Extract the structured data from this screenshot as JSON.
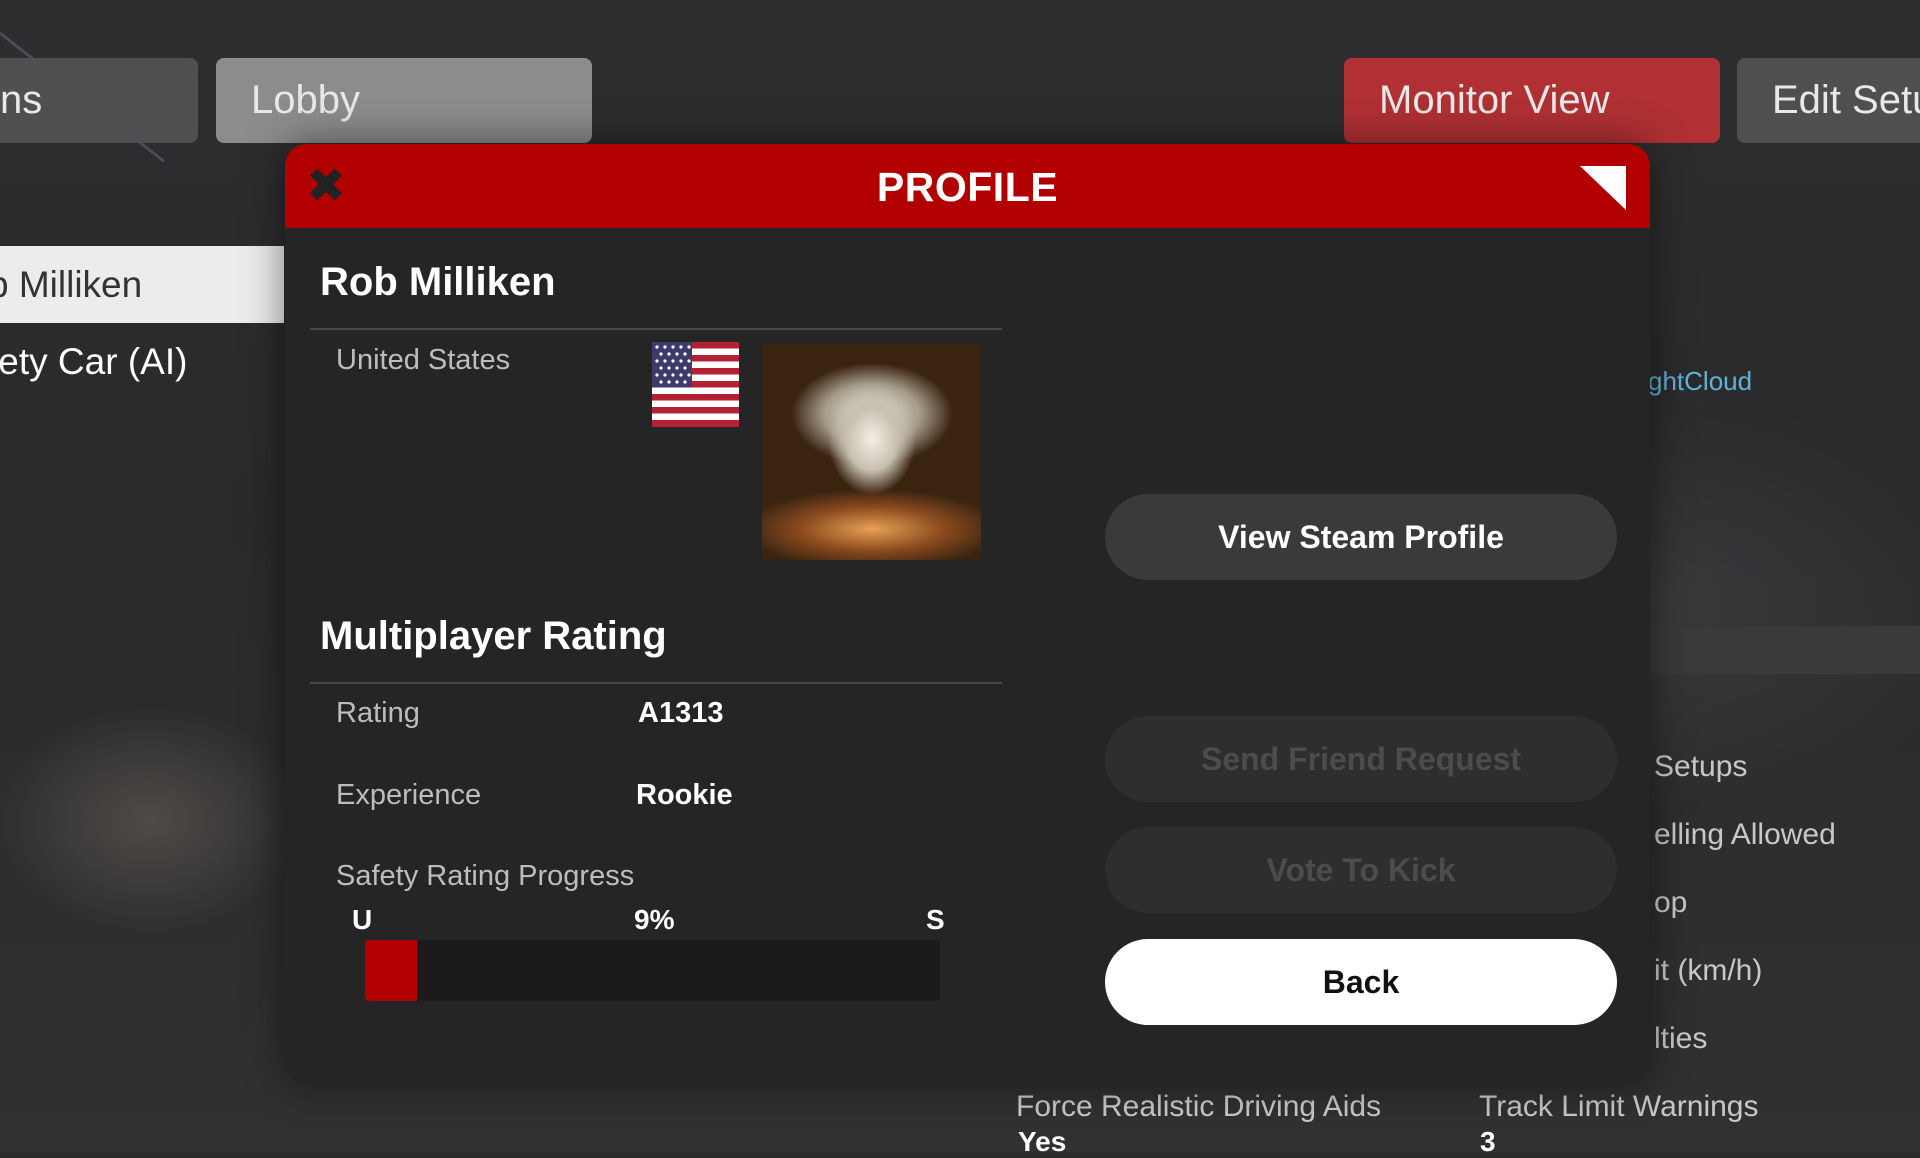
{
  "background": {
    "tabs": {
      "sessions": "ns",
      "lobby": "Lobby",
      "monitor_view": "Monitor View",
      "edit_setup": "Edit Setu"
    },
    "players": [
      "b Milliken",
      "fety Car  (AI)"
    ],
    "cloud_name": "ghtCloud",
    "settings": [
      "Setups",
      "elling Allowed",
      "op",
      "it (km/h)",
      "lties"
    ],
    "bottom": {
      "left_label": "Force Realistic Driving Aids",
      "left_value": "Yes",
      "right_label": "Track Limit Warnings",
      "right_value": "3"
    }
  },
  "modal": {
    "title": "PROFILE",
    "player_name": "Rob Milliken",
    "country": "United States",
    "multiplayer_rating_title": "Multiplayer Rating",
    "rating_label": "Rating",
    "rating_value": "A1313",
    "experience_label": "Experience",
    "experience_value": "Rookie",
    "safety_label": "Safety Rating Progress",
    "safety_from": "U",
    "safety_to": "S",
    "safety_percent_text": "9%",
    "safety_progress": 0.09,
    "buttons": {
      "view_steam": "View Steam Profile",
      "send_friend": "Send Friend Request",
      "vote_kick": "Vote To Kick",
      "back": "Back"
    }
  },
  "colors": {
    "accent": "#b20000",
    "monitor_tab": "#b03033",
    "panel": "#252526"
  },
  "icons": {
    "close": "close-icon",
    "corner": "expand-corner-icon",
    "flag": "us-flag-icon"
  }
}
